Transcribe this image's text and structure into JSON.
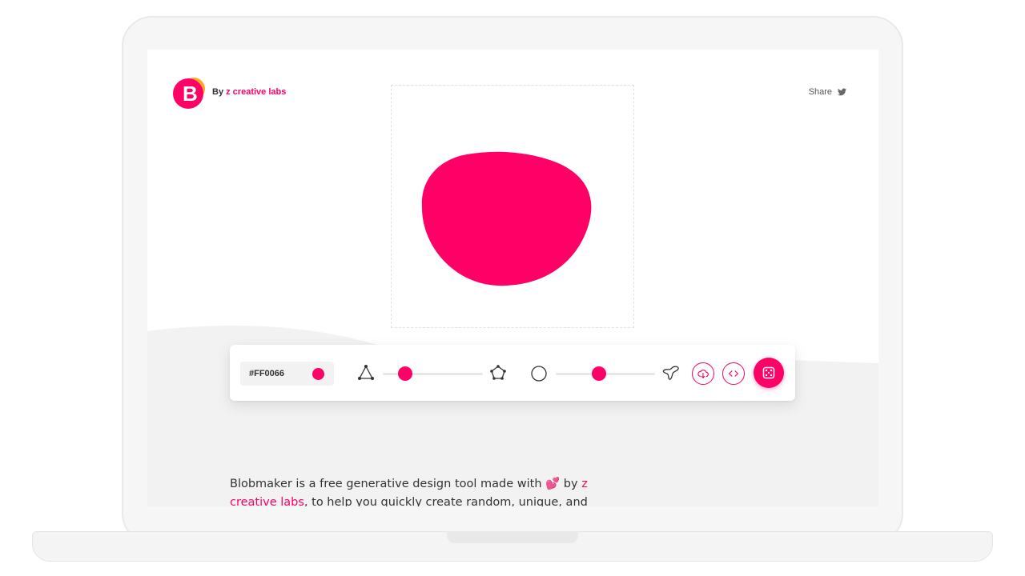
{
  "header": {
    "logo_letter": "B",
    "by_prefix": "By",
    "brand_name": "z creative labs",
    "share_label": "Share",
    "share_icon": "twitter-icon"
  },
  "canvas": {
    "blob_color": "#FF0066"
  },
  "toolbar": {
    "color_hex": "#FF0066",
    "color_swatch": "#ff0066",
    "complexity_min_icon": "triangle-nodes-icon",
    "complexity_max_icon": "pentagon-nodes-icon",
    "contrast_min_icon": "circle-icon",
    "contrast_max_icon": "random-shape-icon",
    "download_icon": "cloud-download-icon",
    "code_icon": "code-icon",
    "randomize_icon": "dice-icon"
  },
  "description": {
    "text_before": "Blobmaker is a free generative design tool made with ",
    "emoji": "💕",
    "text_by": " by ",
    "link_text": "z creative labs",
    "text_after": ", to help you quickly create random, unique, and"
  }
}
